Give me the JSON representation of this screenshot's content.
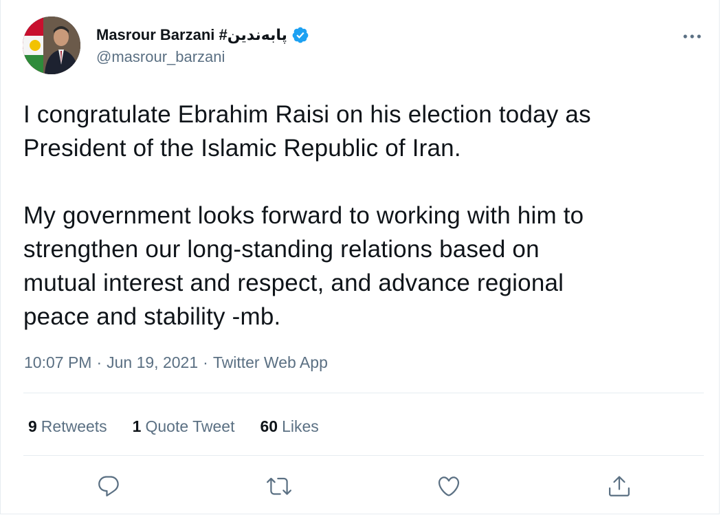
{
  "author": {
    "display_name": "Masrour Barzani #پابەندین",
    "handle": "@masrour_barzani",
    "verified": true
  },
  "tweet": {
    "text": "I congratulate Ebrahim Raisi on his election today as\nPresident of the Islamic Republic of Iran.\n\nMy government looks forward to working with him to\nstrengthen our long-standing relations based on\nmutual interest and respect, and advance regional\npeace and stability -mb."
  },
  "meta": {
    "time": "10:07 PM",
    "separator": "·",
    "date": "Jun 19, 2021",
    "source": "Twitter Web App"
  },
  "stats": {
    "retweets": {
      "count": "9",
      "label": "Retweets"
    },
    "quotes": {
      "count": "1",
      "label": "Quote Tweet"
    },
    "likes": {
      "count": "60",
      "label": "Likes"
    }
  },
  "icons": {
    "verified": "verified-badge-icon",
    "more": "more-horizontal-icon",
    "reply": "reply-icon",
    "retweet": "retweet-icon",
    "like": "heart-icon",
    "share": "share-icon"
  },
  "colors": {
    "text_primary": "#0f1419",
    "text_secondary": "#5b7083",
    "verified_blue": "#1da1f2",
    "divider": "#e6ecf0"
  }
}
